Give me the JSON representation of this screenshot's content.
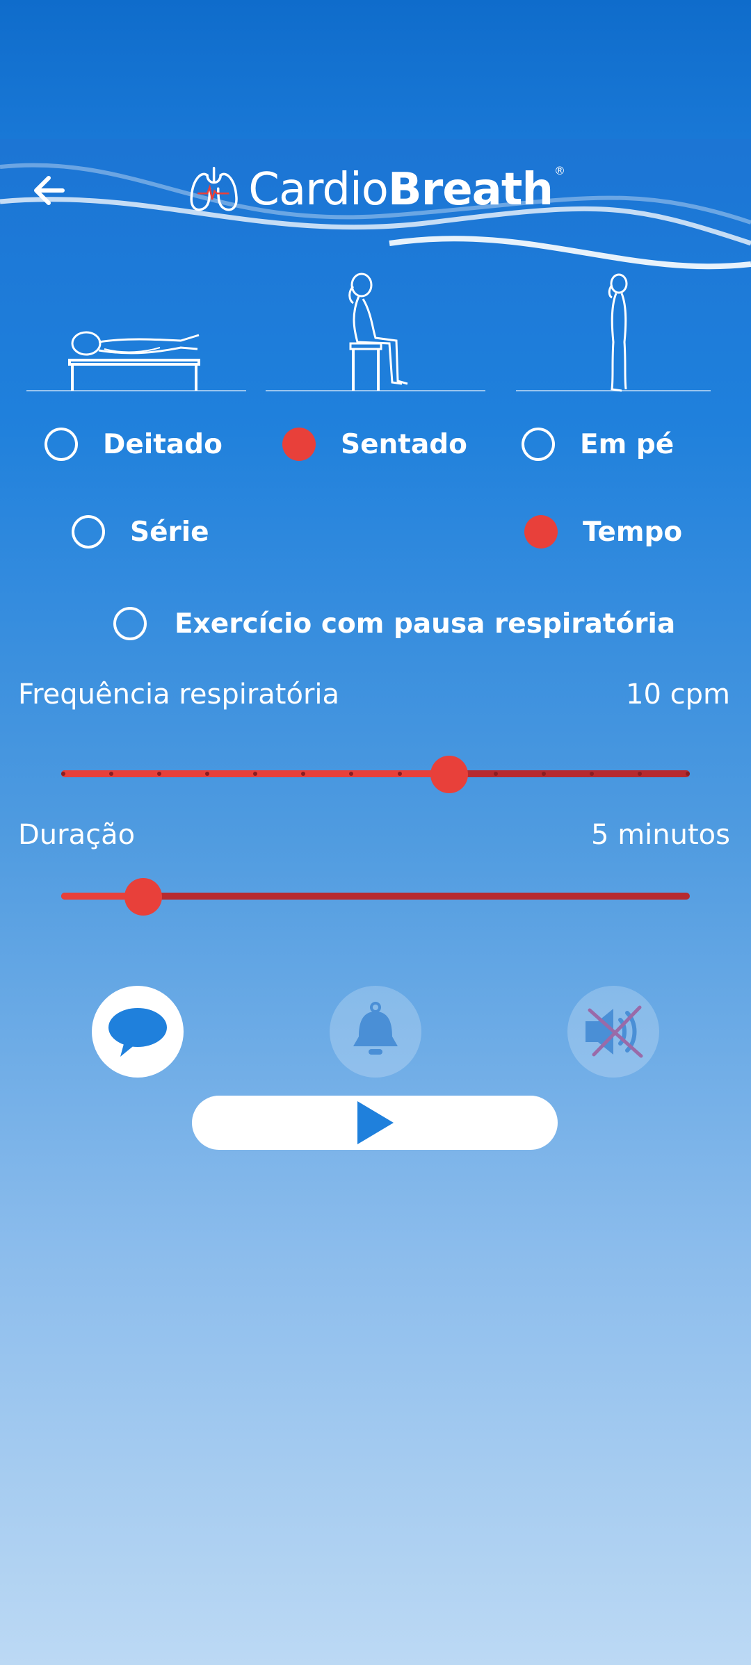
{
  "header": {
    "logo_part1": "Cardio",
    "logo_part2": "Breath",
    "logo_reg": "®"
  },
  "postures": [
    {
      "label": "Deitado",
      "selected": false
    },
    {
      "label": "Sentado",
      "selected": true
    },
    {
      "label": "Em pé",
      "selected": false
    }
  ],
  "mode": [
    {
      "label": "Série",
      "selected": false
    },
    {
      "label": "Tempo",
      "selected": true
    }
  ],
  "pause_option": {
    "label": "Exercício com pausa respiratória",
    "selected": false
  },
  "frequency": {
    "label": "Frequência respiratória",
    "value_text": "10 cpm",
    "fraction": 0.617,
    "ticks": 14
  },
  "duration": {
    "label": "Duração",
    "value_text": "5 minutos",
    "fraction": 0.13
  },
  "controls": {
    "speech_active": true,
    "bell_active": false,
    "sound_muted": true
  },
  "colors": {
    "accent": "#e8403a",
    "track_dark": "#b72a2f",
    "primary_blue": "#1f80dc"
  }
}
